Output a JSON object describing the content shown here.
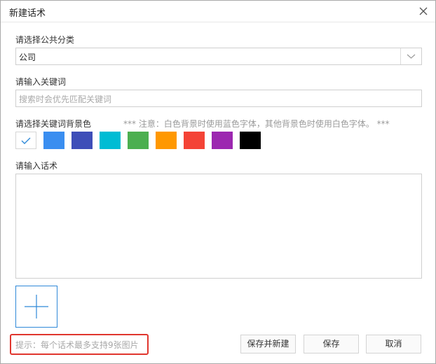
{
  "window": {
    "title": "新建话术"
  },
  "public_category": {
    "label": "请选择公共分类",
    "selected": "公司"
  },
  "keyword": {
    "label": "请输入关键词",
    "placeholder": "搜索时会优先匹配关键词"
  },
  "bg_color": {
    "label": "请选择关键词背景色",
    "note": "*** 注意：白色背景时使用蓝色字体，其他背景色时使用白色字体。 ***",
    "colors": [
      "#ffffff",
      "#3a8ef0",
      "#3e4eb8",
      "#00bcd4",
      "#4caf50",
      "#ff9800",
      "#f44336",
      "#9c27b0",
      "#000000"
    ],
    "selected_index": 0
  },
  "script": {
    "label": "请输入话术"
  },
  "footer": {
    "hint": "提示：每个话术最多支持9张图片",
    "save_new_label": "保存并新建",
    "save_label": "保存",
    "cancel_label": "取消"
  },
  "icons": [
    "close-icon",
    "chevron-down-icon",
    "check-icon",
    "plus-icon"
  ],
  "accent_color": "#2f89d8",
  "highlight_color": "#e0362e"
}
